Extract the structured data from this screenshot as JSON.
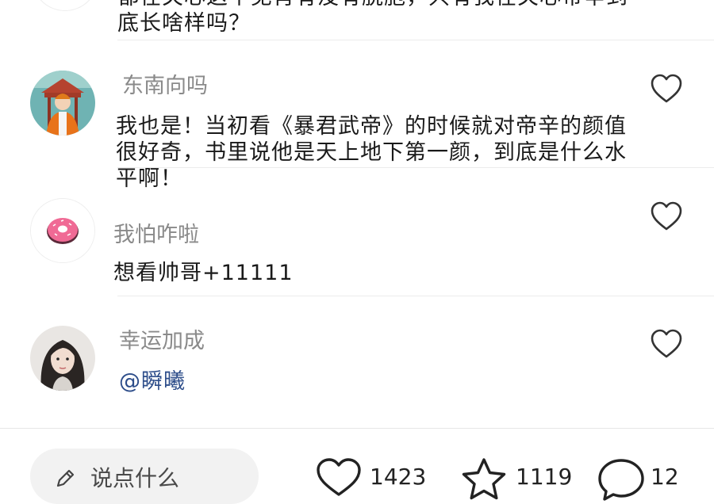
{
  "comments": [
    {
      "text_line1": "都在关心这个见肖有没有脱胞，只有我在关心帝辛到",
      "text_line2": "底长啥样吗？"
    },
    {
      "username": "东南向吗",
      "text": "我也是！当初看《暴君武帝》的时候就对帝辛的颜值很好奇，书里说他是天上地下第一颜，到底是什么水平啊！",
      "avatar": "avatar-pavilion-figure"
    },
    {
      "username": "我怕咋啦",
      "text": "想看帅哥+11111",
      "avatar": "avatar-donut"
    },
    {
      "username": "幸运加成",
      "text": "@瞬曦",
      "avatar": "avatar-girl-portrait"
    }
  ],
  "bottom_bar": {
    "input_placeholder": "说点什么",
    "likes": "1423",
    "favorites": "1119",
    "comments": "12"
  },
  "colors": {
    "username": "#8a8a8a",
    "mention": "#2d4d8a",
    "icon_stroke": "#333333"
  }
}
